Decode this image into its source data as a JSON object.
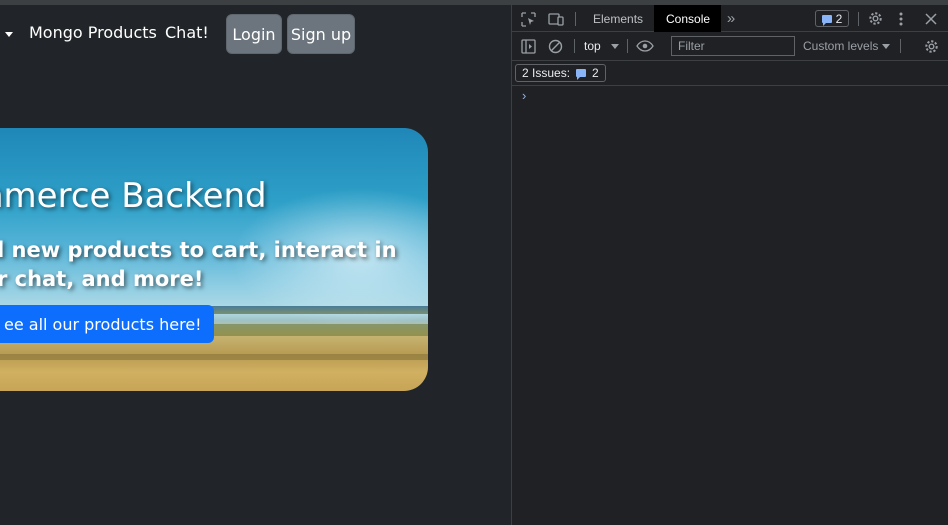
{
  "nav": {
    "products_link": "Mongo Products",
    "chat_link": "Chat!",
    "login_button": "Login",
    "signup_button": "Sign up"
  },
  "hero": {
    "title": "nmerce Backend",
    "subtitle": "ld new products to cart, interact in ur chat, and more!",
    "button_label": "ee all our products here!"
  },
  "devtools": {
    "tabs": [
      {
        "label": "Elements",
        "active": false
      },
      {
        "label": "Console",
        "active": true
      }
    ],
    "issue_count_badge": "2",
    "context": "top",
    "filter_placeholder": "Filter",
    "levels_label": "Custom levels",
    "issues_label": "2 Issues:",
    "issues_count": "2",
    "prompt_symbol": "›"
  },
  "colors": {
    "page_bg": "#212529",
    "primary_button": "#0d6efd",
    "secondary_button": "#6c757d",
    "devtools_bg": "#202124",
    "accent_blue": "#8ab4f8"
  }
}
